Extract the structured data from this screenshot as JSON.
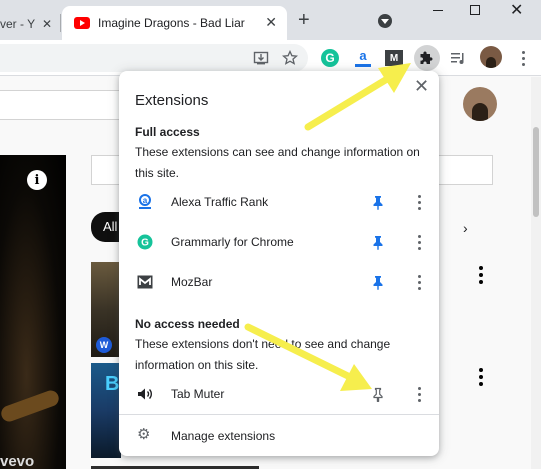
{
  "tabs": {
    "inactive_label": "ver - Y",
    "active_title": "Imagine Dragons - Bad Liar - Y",
    "new_tab": "+"
  },
  "window": {
    "close_glyph": "✕"
  },
  "page": {
    "chip_label": "All",
    "vevo": "vevo",
    "thumb_letter": "B",
    "partial_text": "r"
  },
  "popup": {
    "title": "Extensions",
    "full_access_heading": "Full access",
    "full_access_desc": "These extensions can see and change information on this site.",
    "full_access_items": [
      {
        "name": "Alexa Traffic Rank",
        "icon": "alexa-icon",
        "pinned": true
      },
      {
        "name": "Grammarly for Chrome",
        "icon": "grammarly-icon",
        "pinned": true
      },
      {
        "name": "MozBar",
        "icon": "mozbar-icon",
        "pinned": true
      }
    ],
    "no_access_heading": "No access needed",
    "no_access_desc": "These extensions don't need to see and change information on this site.",
    "no_access_items": [
      {
        "name": "Tab Muter",
        "icon": "speaker-icon",
        "pinned": false
      }
    ],
    "manage_label": "Manage extensions"
  },
  "colors": {
    "pin_active": "#1a73e8",
    "pin_inactive": "#5f6368",
    "arrow": "#f6ee4d",
    "youtube_red": "#ff0000",
    "grammarly_green": "#15c39a"
  }
}
